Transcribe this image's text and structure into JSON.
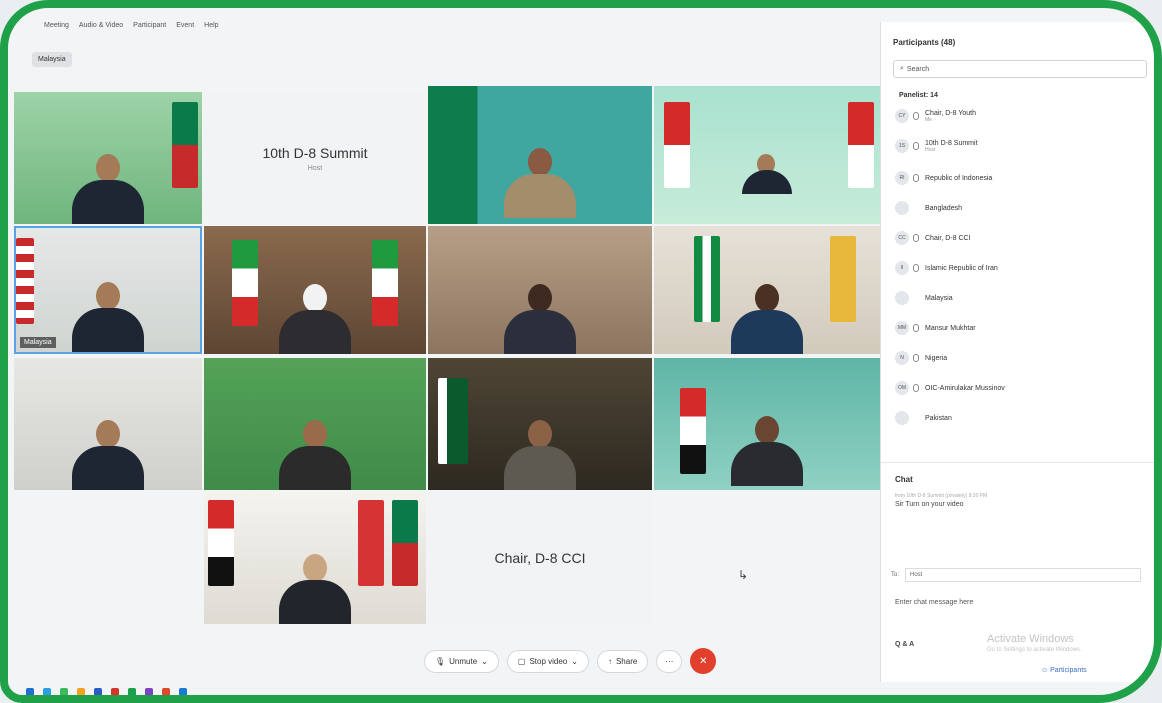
{
  "menu": [
    "Meeting",
    "Audio & Video",
    "Participant",
    "Event",
    "Help"
  ],
  "view_tag": "Malaysia",
  "tiles": [
    {
      "id": "t1",
      "label": "",
      "type": "video"
    },
    {
      "id": "t2",
      "label": "10th D-8 Summit",
      "sub": "Host",
      "type": "placeholder"
    },
    {
      "id": "t3",
      "label": "",
      "type": "video"
    },
    {
      "id": "t4",
      "label": "",
      "type": "video"
    },
    {
      "id": "t5",
      "label": "",
      "type": "video",
      "namebar": "Malaysia"
    },
    {
      "id": "t6",
      "label": "",
      "type": "video"
    },
    {
      "id": "t7",
      "label": "",
      "type": "video"
    },
    {
      "id": "t8",
      "label": "",
      "type": "video"
    },
    {
      "id": "t9",
      "label": "",
      "type": "video"
    },
    {
      "id": "t10",
      "label": "",
      "type": "video"
    },
    {
      "id": "t11",
      "label": "",
      "type": "video"
    },
    {
      "id": "t12",
      "label": "",
      "type": "video"
    },
    {
      "id": "t13",
      "label": "",
      "type": "video"
    },
    {
      "id": "t14",
      "label": "Chair, D-8 CCI",
      "type": "placeholder"
    }
  ],
  "toolbar": {
    "unmute": "Unmute",
    "stop_video": "Stop video",
    "share": "Share"
  },
  "participants": {
    "title": "Participants (48)",
    "search_placeholder": "Search",
    "group": "Panelist: 14",
    "rows": [
      {
        "initials": "CY",
        "name": "Chair, D-8 Youth",
        "sub": "Me"
      },
      {
        "initials": "1S",
        "name": "10th D-8 Summit",
        "sub": "Host"
      },
      {
        "initials": "RI",
        "name": "Republic of Indonesia",
        "sub": ""
      },
      {
        "initials": "",
        "name": "Bangladesh",
        "sub": ""
      },
      {
        "initials": "CC",
        "name": "Chair, D-8 CCI",
        "sub": ""
      },
      {
        "initials": "II",
        "name": "Islamic Republic of Iran",
        "sub": ""
      },
      {
        "initials": "",
        "name": "Malaysia",
        "sub": ""
      },
      {
        "initials": "MM",
        "name": "Mansur Mukhtar",
        "sub": ""
      },
      {
        "initials": "N",
        "name": "Nigeria",
        "sub": ""
      },
      {
        "initials": "OM",
        "name": "OIC-Amirulakar Mussinov",
        "sub": ""
      },
      {
        "initials": "",
        "name": "Pakistan",
        "sub": ""
      }
    ]
  },
  "chat": {
    "title": "Chat",
    "meta": "from 10th D-8 Summit (privately)   9:20 PM",
    "message": "Sir Turn on your video",
    "to_label": "To:",
    "to_value": "Host",
    "input_placeholder": "Enter chat message here",
    "qa": "Q & A",
    "activate_title": "Activate Windows",
    "activate_sub": "Go to Settings to activate Windows.",
    "participants_button": "Participants"
  },
  "colors": {
    "frame": "#1fa14a",
    "end_call": "#e2402c",
    "link": "#3a6fc4"
  }
}
